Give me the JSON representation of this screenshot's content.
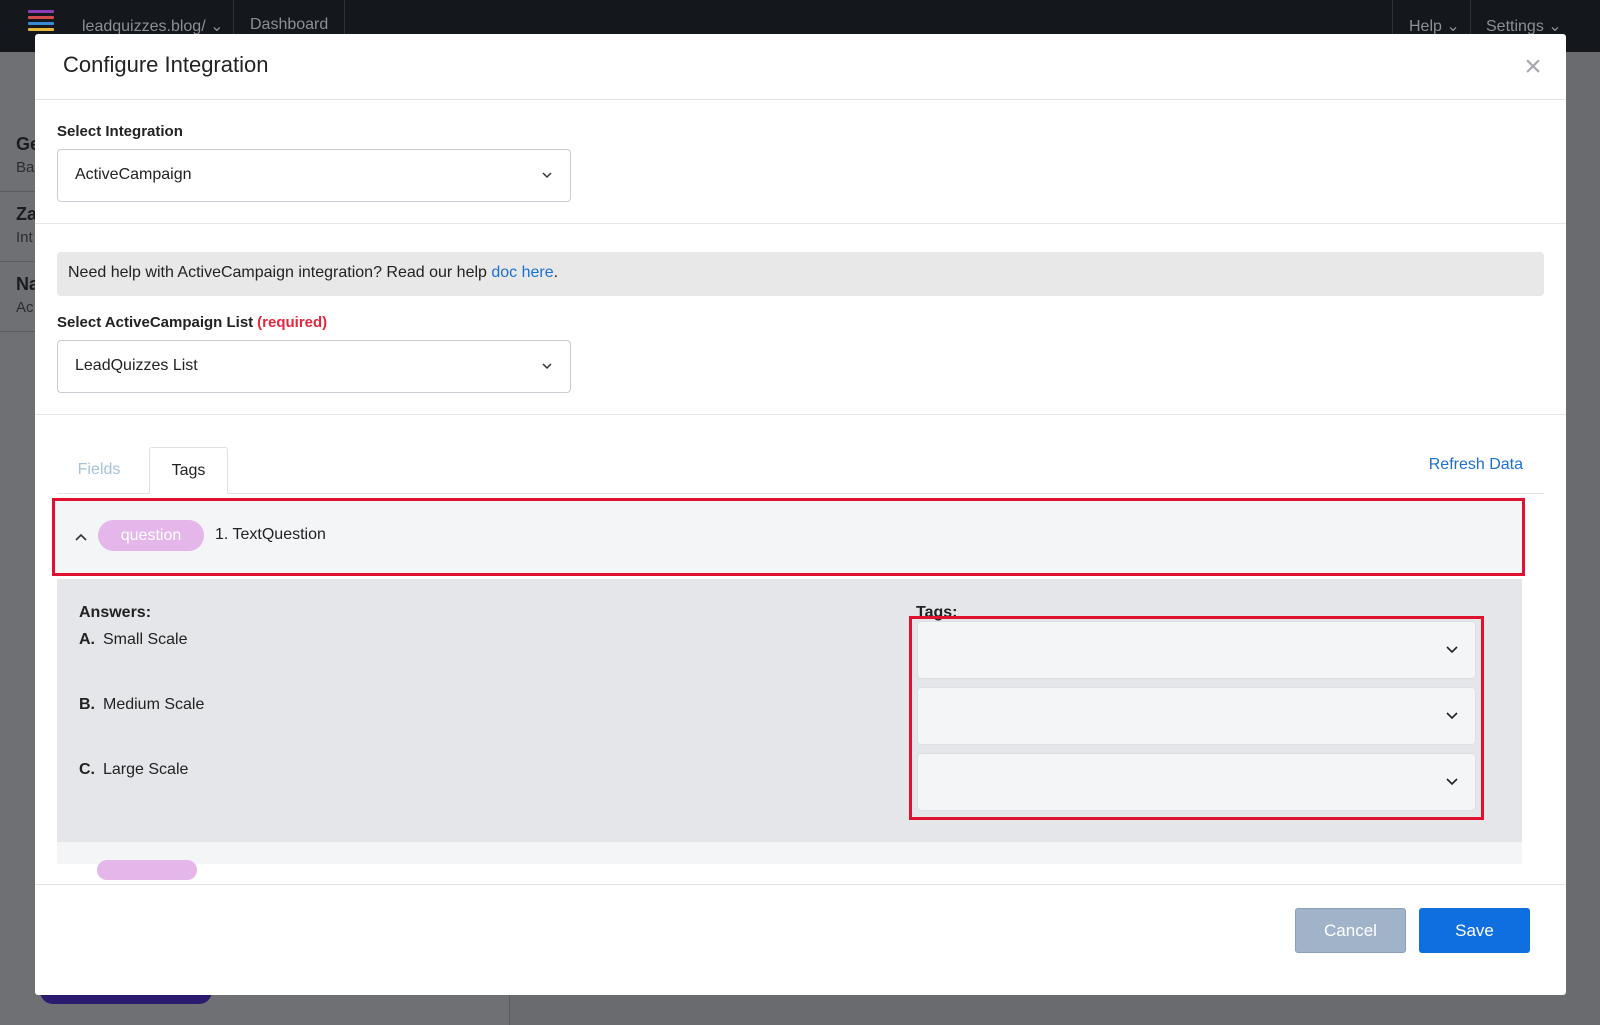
{
  "topbar": {
    "site": "leadquizzes.blog/",
    "dashboard": "Dashboard",
    "help": "Help",
    "settings": "Settings"
  },
  "background": {
    "side_items": [
      {
        "title": "Ge",
        "subtitle": "Ba"
      },
      {
        "title": "Za",
        "subtitle": "Int"
      },
      {
        "title": "Na",
        "subtitle": "Ac"
      }
    ]
  },
  "modal": {
    "title": "Configure Integration",
    "close_symbol": "×",
    "integration": {
      "label": "Select Integration",
      "value": "ActiveCampaign"
    },
    "help": {
      "text": "Need help with ActiveCampaign integration? Read our help ",
      "link_text": "doc here",
      "suffix": "."
    },
    "list": {
      "label": "Select ActiveCampaign List",
      "required": "(required)",
      "value": "LeadQuizzes List"
    },
    "tabs": {
      "fields": "Fields",
      "tags": "Tags",
      "active": "Tags"
    },
    "refresh": "Refresh Data",
    "question": {
      "badge": "question",
      "title": "1. TextQuestion",
      "answers_label": "Answers:",
      "tags_label": "Tags:",
      "answers": [
        {
          "letter": "A.",
          "text": "Small Scale"
        },
        {
          "letter": "B.",
          "text": "Medium Scale"
        },
        {
          "letter": "C.",
          "text": "Large Scale"
        }
      ]
    },
    "footer": {
      "cancel": "Cancel",
      "save": "Save"
    }
  },
  "colors": {
    "accent": "#0f6fe0",
    "link": "#1d6fd1",
    "highlight": "#e0102f",
    "badge": "#e4b6ea",
    "required": "#e0283f"
  }
}
